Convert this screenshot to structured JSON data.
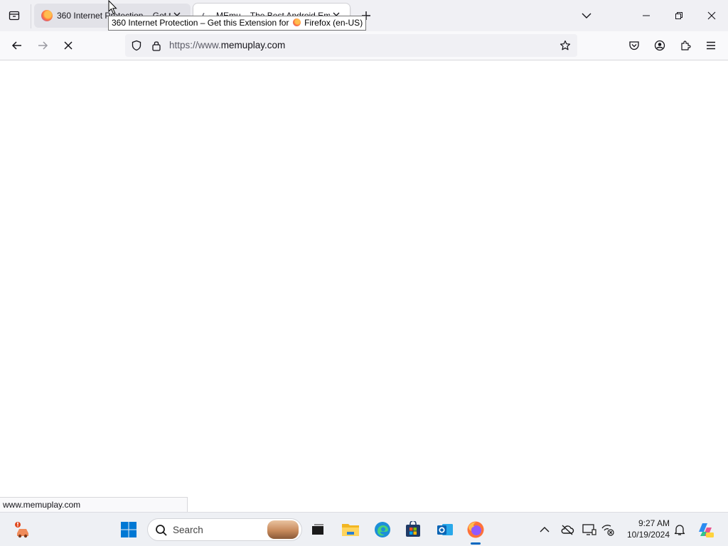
{
  "tabs": [
    {
      "title": "360 Internet Protection – Get this Extension for Firefox (en-US)",
      "state": "inactive"
    },
    {
      "title": "MEmu – The Best Android Emulator",
      "state": "active-loading"
    }
  ],
  "tooltip": {
    "prefix": "360 Internet Protection – Get this Extension for",
    "suffix": "Firefox (en-US)"
  },
  "navbar": {
    "url_scheme": "https://www.",
    "url_host": "memuplay.com"
  },
  "status_bar": {
    "text": "www.memuplay.com"
  },
  "taskbar": {
    "search_placeholder": "Search",
    "clock_time": "9:27 AM",
    "clock_date": "10/19/2024",
    "pinned_apps": [
      "widgets",
      "start",
      "search",
      "task-view",
      "file-explorer",
      "edge",
      "store",
      "outlook",
      "firefox"
    ],
    "tray_icons": [
      "show-hidden-icons",
      "onedrive",
      "display",
      "network-status",
      "notifications",
      "copilot"
    ]
  },
  "colors": {
    "accent": "#0067c0",
    "tabstrip": "#f0f0f4",
    "urlbar": "#f0f0f4",
    "taskbar": "#eef0f4"
  }
}
